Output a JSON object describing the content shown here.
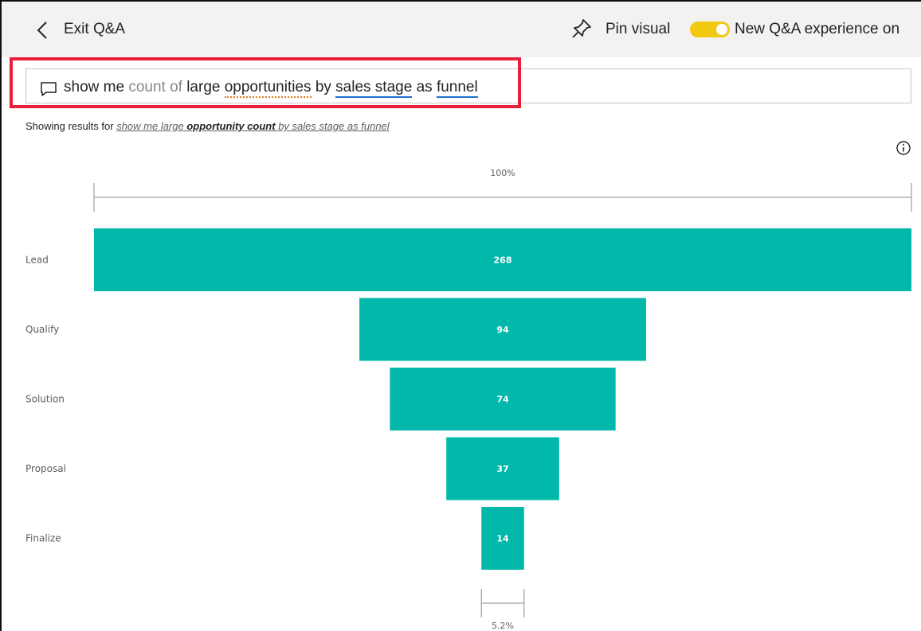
{
  "header": {
    "exit_label": "Exit Q&A",
    "pin_label": "Pin visual",
    "toggle_label": "New Q&A experience on",
    "toggle_state": "on",
    "toggle_color": "#f2c811"
  },
  "question": {
    "icon": "chat-icon",
    "words": [
      {
        "text": "show me",
        "style": "plain"
      },
      {
        "text": "count of",
        "style": "faded"
      },
      {
        "text": "large",
        "style": "plain"
      },
      {
        "text": "opportunities",
        "style": "dotted"
      },
      {
        "text": "by",
        "style": "plain"
      },
      {
        "text": "sales stage",
        "style": "underline"
      },
      {
        "text": "as",
        "style": "plain"
      },
      {
        "text": "funnel",
        "style": "underline"
      }
    ]
  },
  "results": {
    "prefix": "Showing results for",
    "part1": "show me large",
    "bold": "opportunity count",
    "part2": "by sales stage as funnel"
  },
  "chart_data": {
    "type": "funnel",
    "categories": [
      "Lead",
      "Qualify",
      "Solution",
      "Proposal",
      "Finalize"
    ],
    "values": [
      268,
      94,
      74,
      37,
      14
    ],
    "top_label": "100%",
    "bottom_label": "5.2%",
    "bar_color": "#01b8aa"
  }
}
